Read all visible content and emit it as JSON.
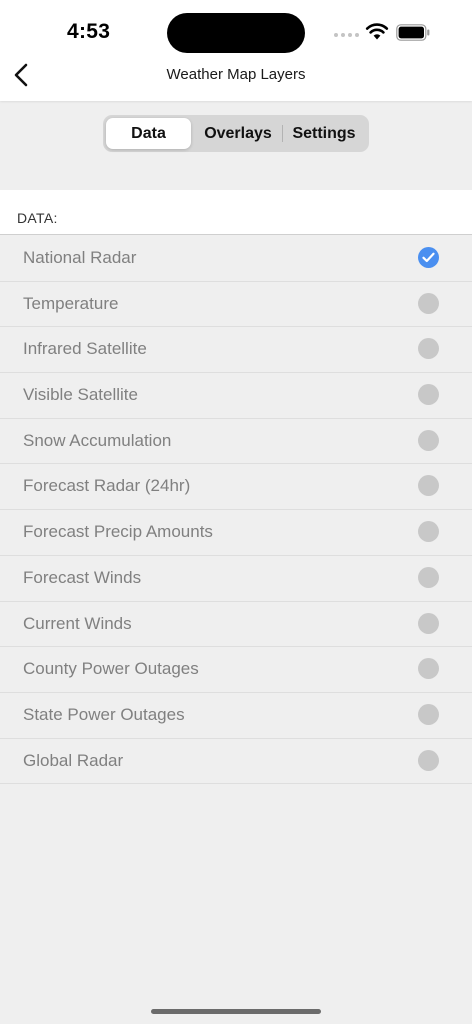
{
  "status_bar": {
    "time": "4:53"
  },
  "nav": {
    "title": "Weather Map Layers"
  },
  "segments": [
    {
      "label": "Data",
      "selected": true
    },
    {
      "label": "Overlays",
      "selected": false
    },
    {
      "label": "Settings",
      "selected": false
    }
  ],
  "section": {
    "title": "DATA:"
  },
  "layers": [
    {
      "label": "National Radar",
      "selected": true
    },
    {
      "label": "Temperature",
      "selected": false
    },
    {
      "label": "Infrared Satellite",
      "selected": false
    },
    {
      "label": "Visible Satellite",
      "selected": false
    },
    {
      "label": "Snow Accumulation",
      "selected": false
    },
    {
      "label": "Forecast Radar (24hr)",
      "selected": false
    },
    {
      "label": "Forecast Precip Amounts",
      "selected": false
    },
    {
      "label": "Forecast Winds",
      "selected": false
    },
    {
      "label": "Current Winds",
      "selected": false
    },
    {
      "label": "County Power Outages",
      "selected": false
    },
    {
      "label": "State Power Outages",
      "selected": false
    },
    {
      "label": "Global Radar",
      "selected": false
    }
  ],
  "colors": {
    "accent": "#4a8ff0",
    "unselected_radio": "#c8c8c8",
    "background": "#efefef"
  },
  "icons": {
    "back": "chevron-left-icon",
    "selected": "checkmark-circle-icon",
    "unselected": "empty-circle-icon"
  }
}
